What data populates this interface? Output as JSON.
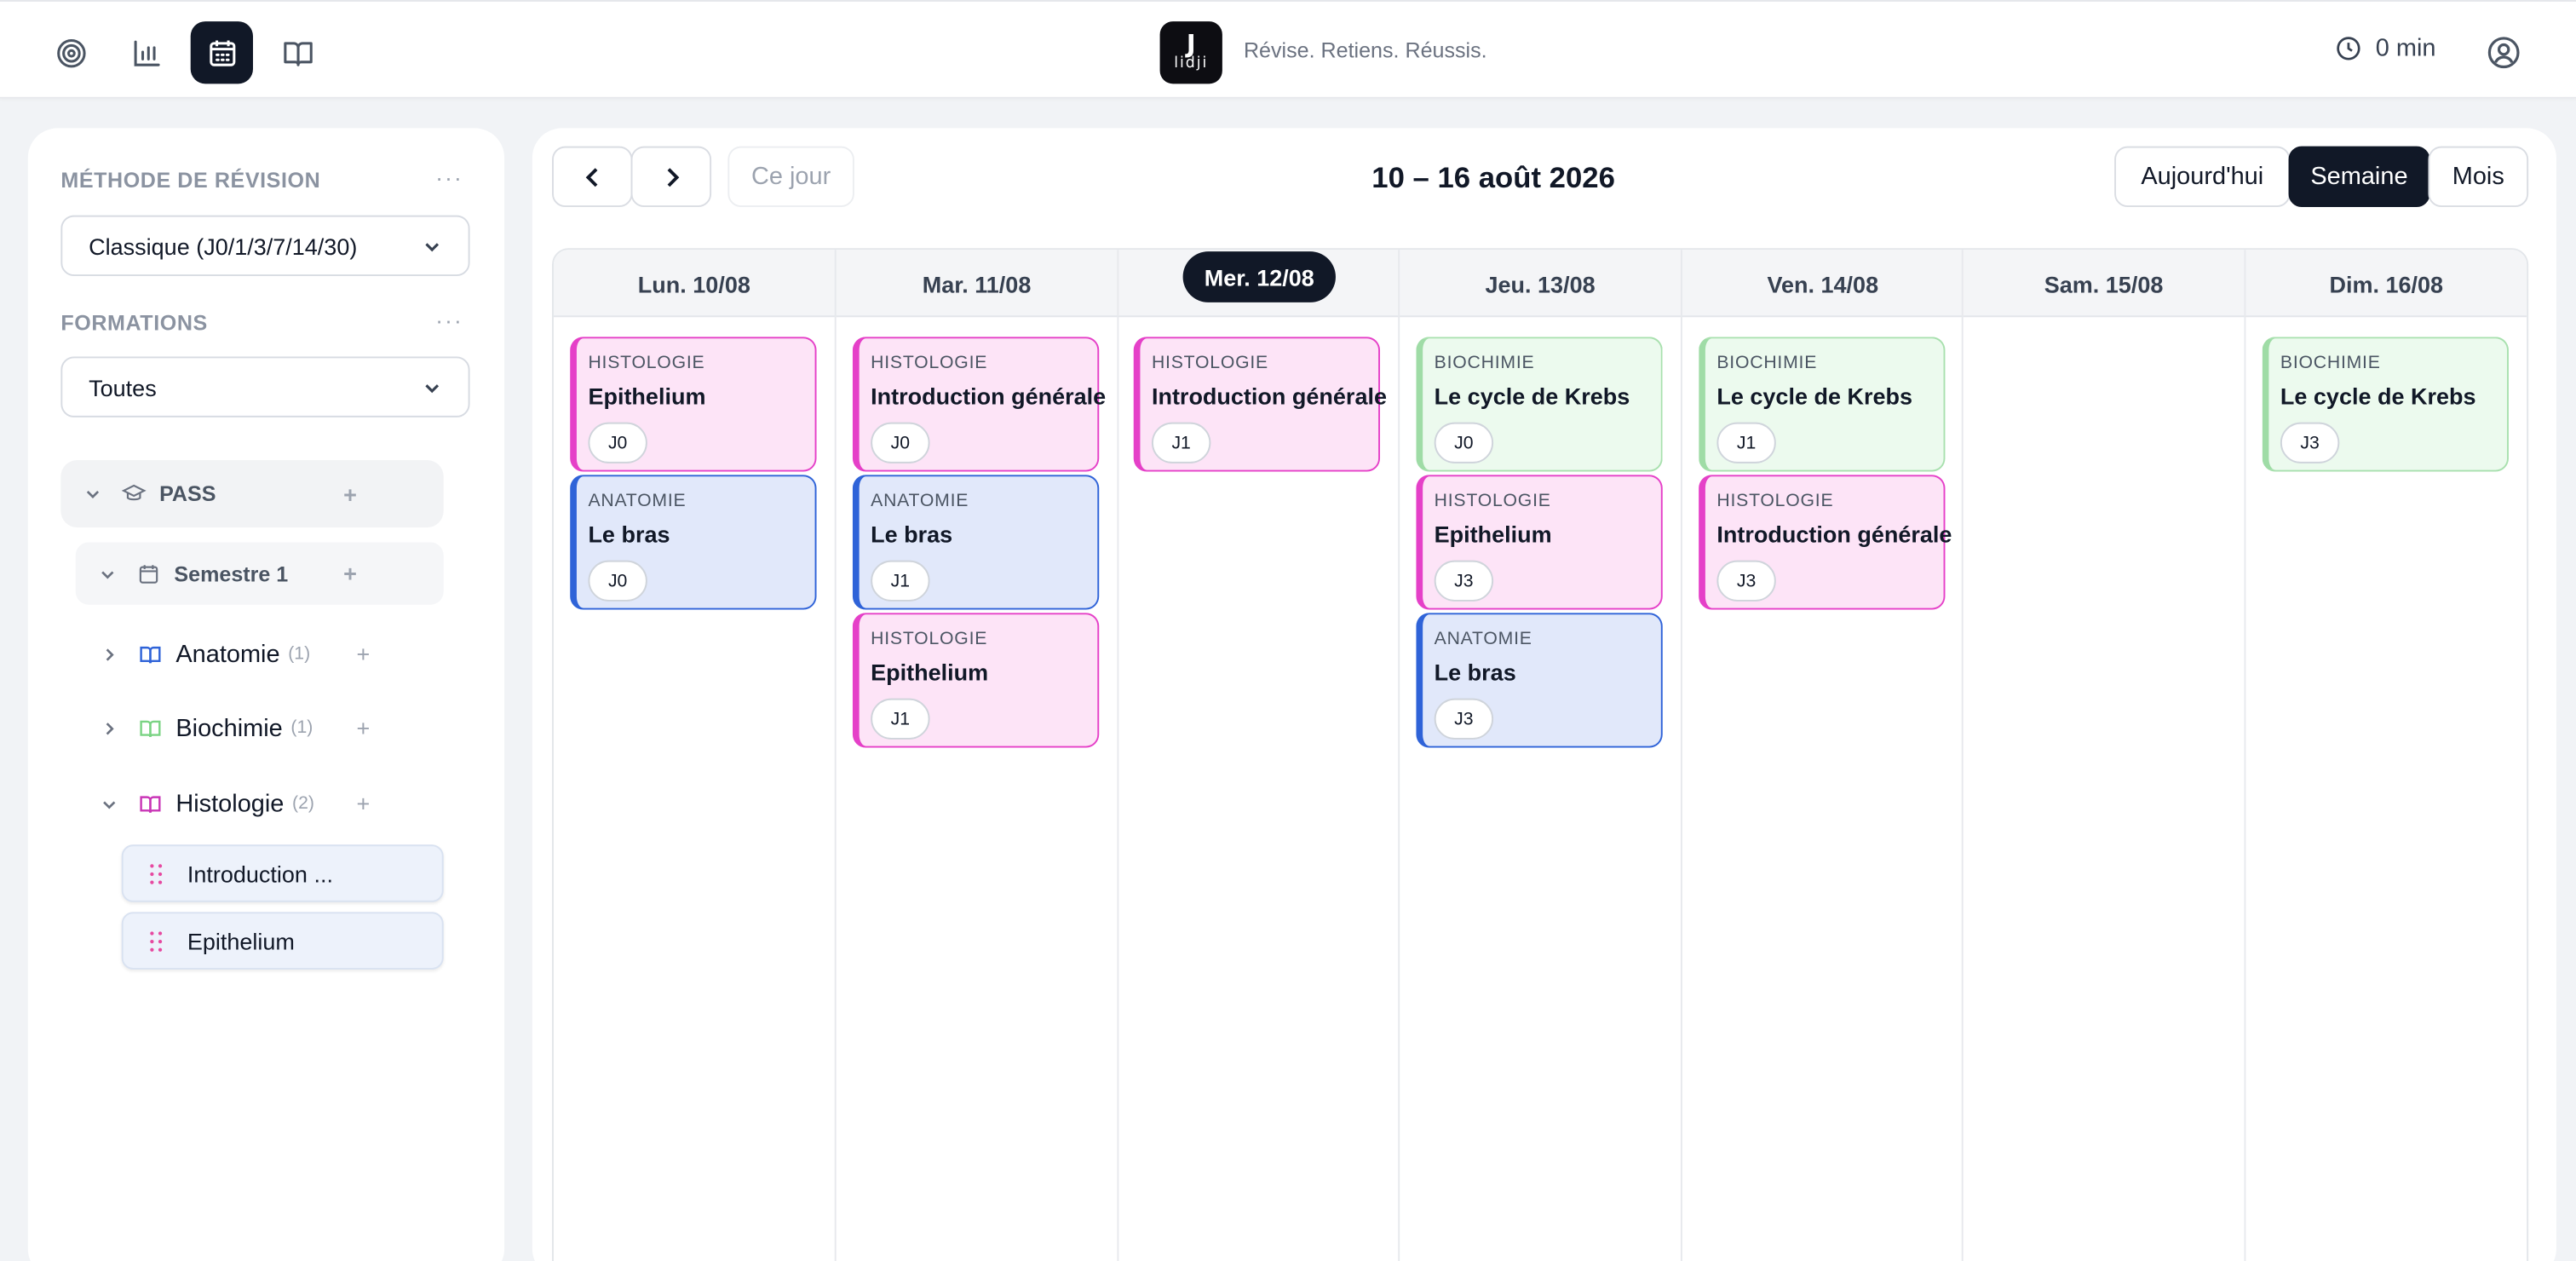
{
  "header": {
    "tagline": "Révise. Retiens. Réussis.",
    "logo_letter": "J",
    "logo_word": "lidji",
    "timer": "0 min",
    "nav_icons": [
      "target-icon",
      "stats-icon",
      "calendar-icon",
      "book-icon"
    ],
    "active_nav": "calendar-icon"
  },
  "sidebar": {
    "method_label": "MÉTHODE DE RÉVISION",
    "method_value": "Classique (J0/1/3/7/14/30)",
    "formations_label": "FORMATIONS",
    "formations_value": "Toutes",
    "menu_dots": "···",
    "tree": {
      "root": "PASS",
      "semester": "Semestre 1",
      "subjects": [
        {
          "name": "Anatomie",
          "count": "(1)",
          "color": "#2f63d8"
        },
        {
          "name": "Biochimie",
          "count": "(1)",
          "color": "#7ad383"
        },
        {
          "name": "Histologie",
          "count": "(2)",
          "color": "#c935b6"
        }
      ],
      "chapters": [
        "Introduction ...",
        "Epithelium"
      ],
      "plus": "+"
    }
  },
  "toolbar": {
    "today_short": "Ce jour",
    "range_title": "10 – 16 août 2026",
    "today": "Aujourd'hui",
    "week": "Semaine",
    "month": "Mois"
  },
  "calendar": {
    "days": [
      "Lun. 10/08",
      "Mar. 11/08",
      "Mer. 12/08",
      "Jeu. 13/08",
      "Ven. 14/08",
      "Sam. 15/08",
      "Dim. 16/08"
    ],
    "today_index": 2,
    "colors": {
      "histologie": "#e540c8",
      "anatomie": "#2f63d8",
      "biochimie": "#a8e0ae"
    },
    "cards": {
      "mon": [
        {
          "subject": "HISTOLOGIE",
          "title": "Epithelium",
          "tag": "J0"
        },
        {
          "subject": "ANATOMIE",
          "title": "Le bras",
          "tag": "J0"
        }
      ],
      "tue": [
        {
          "subject": "HISTOLOGIE",
          "title": "Introduction générale",
          "tag": "J0"
        },
        {
          "subject": "ANATOMIE",
          "title": "Le bras",
          "tag": "J1"
        },
        {
          "subject": "HISTOLOGIE",
          "title": "Epithelium",
          "tag": "J1"
        }
      ],
      "wed": [
        {
          "subject": "HISTOLOGIE",
          "title": "Introduction générale",
          "tag": "J1"
        }
      ],
      "thu": [
        {
          "subject": "BIOCHIMIE",
          "title": "Le cycle de Krebs",
          "tag": "J0"
        },
        {
          "subject": "HISTOLOGIE",
          "title": "Epithelium",
          "tag": "J3"
        },
        {
          "subject": "ANATOMIE",
          "title": "Le bras",
          "tag": "J3"
        }
      ],
      "fri": [
        {
          "subject": "BIOCHIMIE",
          "title": "Le cycle de Krebs",
          "tag": "J1"
        },
        {
          "subject": "HISTOLOGIE",
          "title": "Introduction générale",
          "tag": "J3"
        }
      ],
      "sun": [
        {
          "subject": "BIOCHIMIE",
          "title": "Le cycle de Krebs",
          "tag": "J3"
        }
      ]
    }
  }
}
